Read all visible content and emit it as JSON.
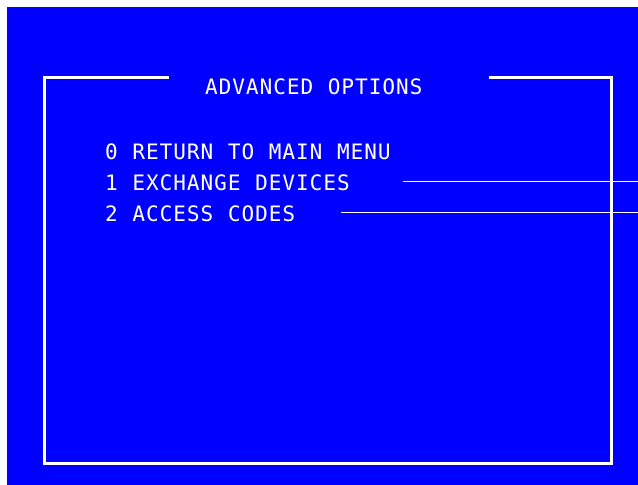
{
  "screen": {
    "title": "ADVANCED OPTIONS",
    "background": "#0000ff",
    "foreground": "#ffffff"
  },
  "menu": {
    "items": [
      {
        "key": "0",
        "label": "RETURN TO MAIN MENU"
      },
      {
        "key": "1",
        "label": "EXCHANGE DEVICES"
      },
      {
        "key": "2",
        "label": "ACCESS CODES"
      }
    ]
  }
}
